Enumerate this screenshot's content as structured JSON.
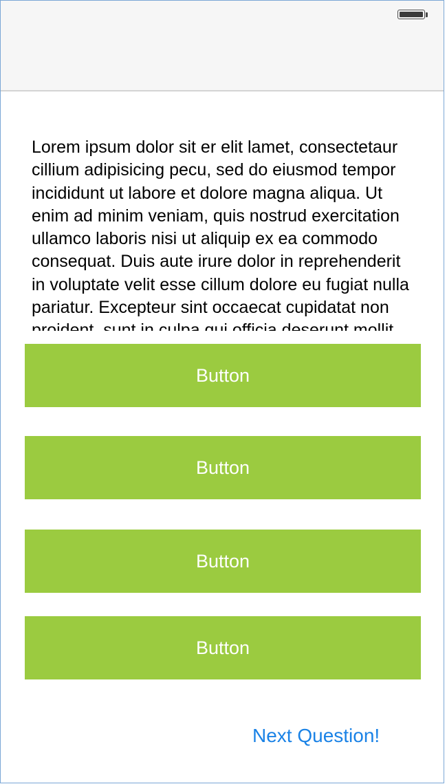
{
  "question": {
    "text": "Lorem ipsum dolor sit er elit lamet, consectetaur cillium adipisicing pecu, sed do eiusmod tempor incididunt ut labore et dolore magna aliqua. Ut enim ad minim veniam, quis nostrud exercitation ullamco laboris nisi ut aliquip ex ea commodo consequat. Duis aute irure dolor in reprehenderit in voluptate velit esse cillum dolore eu fugiat nulla pariatur. Excepteur sint occaecat cupidatat non proident, sunt in culpa qui officia deserunt mollit anim id est laborum."
  },
  "answers": [
    {
      "label": "Button"
    },
    {
      "label": "Button"
    },
    {
      "label": "Button"
    },
    {
      "label": "Button"
    }
  ],
  "footer": {
    "next_label": "Next Question!"
  },
  "status_bar": {
    "battery_icon": "battery-full-icon"
  },
  "colors": {
    "button_bg": "#9bcb40",
    "button_text": "#ffffff",
    "link": "#1a82e6",
    "status_bar_bg": "#f6f6f6"
  }
}
